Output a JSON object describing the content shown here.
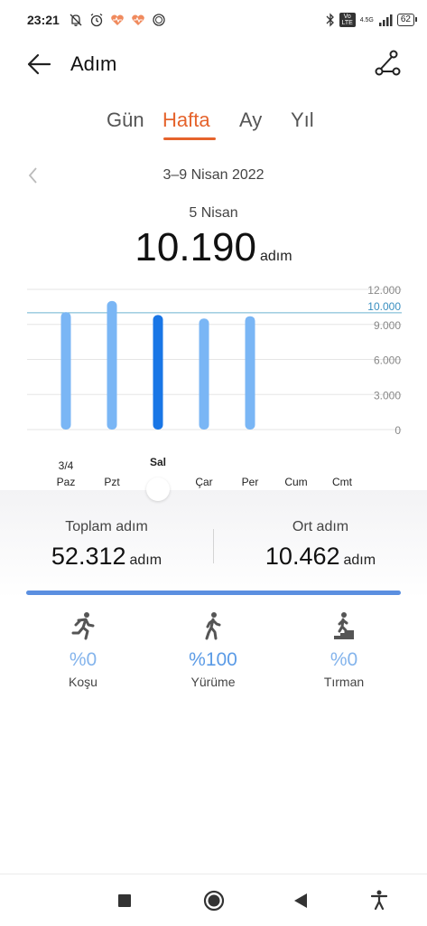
{
  "status_bar": {
    "time": "23:21",
    "network": "4.5G",
    "volte": "Vo LTE",
    "battery": "62"
  },
  "app_bar": {
    "title": "Adım"
  },
  "tabs": [
    {
      "label": "Gün",
      "active": false
    },
    {
      "label": "Hafta",
      "active": true
    },
    {
      "label": "Ay",
      "active": false
    },
    {
      "label": "Yıl",
      "active": false
    }
  ],
  "date_range": "3–9 Nisan 2022",
  "selected": {
    "date": "5 Nisan",
    "value": "10.190",
    "unit": "adım"
  },
  "chart_data": {
    "type": "bar",
    "categories": [
      "Paz",
      "Pzt",
      "Sal",
      "Çar",
      "Per",
      "Cum",
      "Cmt"
    ],
    "category_top_labels": [
      "3/4",
      "",
      "",
      "",
      "",
      "",
      ""
    ],
    "values": [
      10050,
      11000,
      9800,
      9500,
      9700,
      0,
      0
    ],
    "selected_index": 2,
    "ylim": [
      0,
      12000
    ],
    "y_ticks": [
      "12.000",
      "9.000",
      "6.000",
      "3.000",
      "0"
    ],
    "y_tick_values": [
      12000,
      9000,
      6000,
      3000,
      0
    ],
    "goal_value": 10000,
    "goal_label": "10.000",
    "colors": {
      "bar": "#7ab6f5",
      "bar_selected": "#1976e6",
      "goal": "#6cb3d0",
      "grid": "#e6e6e6",
      "tick": "#888888"
    }
  },
  "summary": {
    "total_label": "Toplam adım",
    "total_value": "52.312",
    "avg_label": "Ort adım",
    "avg_value": "10.462",
    "unit": "adım",
    "bar_color": "#5b8fe0"
  },
  "activities": [
    {
      "icon": "running-icon",
      "pct": "%0",
      "label": "Koşu"
    },
    {
      "icon": "walking-icon",
      "pct": "%100",
      "label": "Yürüme"
    },
    {
      "icon": "climbing-icon",
      "pct": "%0",
      "label": "Tırman"
    }
  ]
}
